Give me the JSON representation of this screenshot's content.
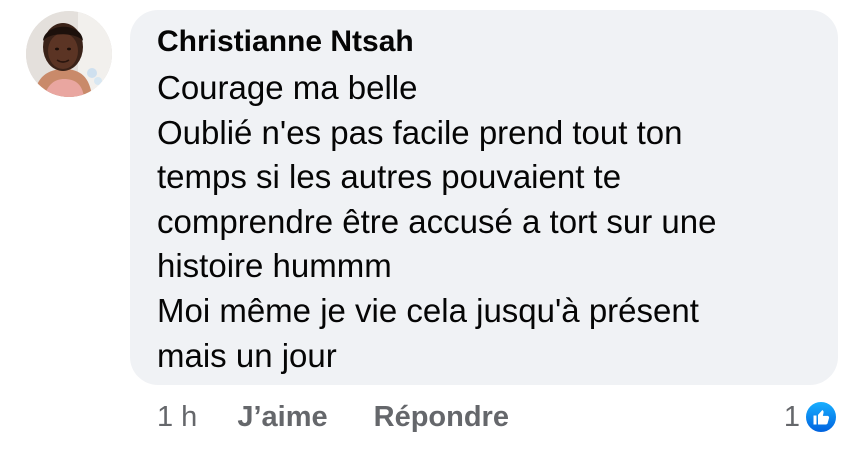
{
  "comment": {
    "author": "Christianne Ntsah",
    "lines": [
      "Courage ma belle",
      "Oublié n'es pas facile prend tout ton",
      "temps si les autres pouvaient te",
      "comprendre être accusé a tort sur une",
      "histoire hummm",
      "Moi même je vie cela jusqu'à présent",
      "mais un jour"
    ],
    "timestamp": "1 h",
    "like_label": "J’aime",
    "reply_label": "Répondre",
    "reaction_count": "1",
    "reaction_icon": "like-thumbs-up-icon",
    "colors": {
      "bubble": "#f0f2f5",
      "text": "#050505",
      "meta": "#65676b",
      "like_blue": "#0866ff"
    }
  }
}
